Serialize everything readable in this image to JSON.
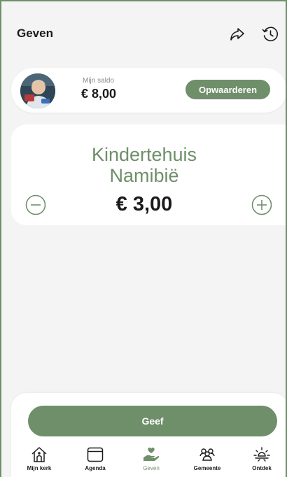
{
  "header": {
    "title": "Geven",
    "share_icon": "share-forward-icon",
    "history_icon": "history-icon"
  },
  "wallet": {
    "balance_label": "Mijn saldo",
    "balance_value": "€ 8,00",
    "topup_label": "Opwaarderen"
  },
  "goal": {
    "title_line1": "Kindertehuis",
    "title_line2": "Namibië",
    "amount": "€ 3,00",
    "decrease_icon": "minus-circle-icon",
    "increase_icon": "plus-circle-icon"
  },
  "action": {
    "give_label": "Geef"
  },
  "tabs": [
    {
      "label": "Mijn kerk",
      "icon": "church-house-icon"
    },
    {
      "label": "Agenda",
      "icon": "calendar-icon"
    },
    {
      "label": "Geven",
      "icon": "giving-hand-heart-icon",
      "active": true
    },
    {
      "label": "Gemeente",
      "icon": "people-group-icon"
    },
    {
      "label": "Ontdek",
      "icon": "sun-discover-icon"
    }
  ],
  "colors": {
    "accent": "#6f8f6a",
    "text": "#1b1b1b",
    "background": "#f4f4f4",
    "card": "#ffffff"
  }
}
